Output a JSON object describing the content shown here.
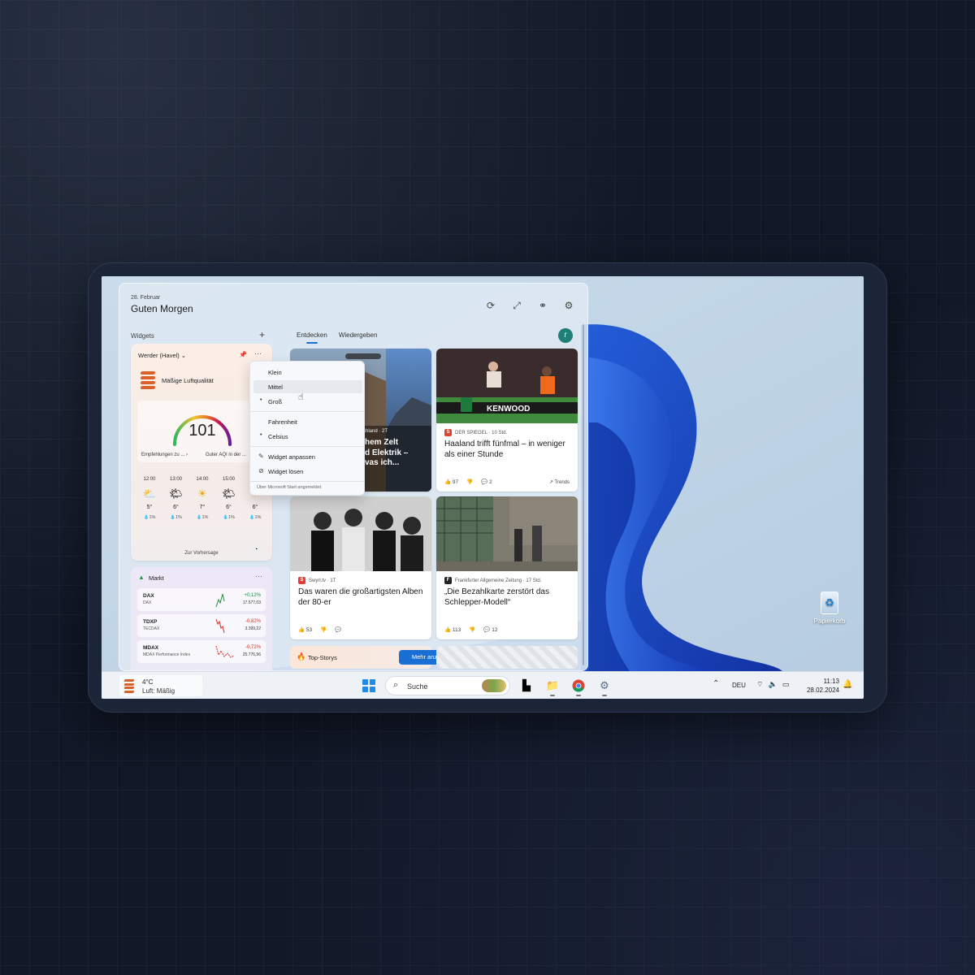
{
  "header": {
    "date": "28. Februar",
    "greeting": "Guten Morgen",
    "icons": [
      "refresh-icon",
      "expand-icon",
      "people-icon",
      "settings-icon"
    ]
  },
  "widgets_label": "Widgets",
  "tabs": [
    {
      "label": "Entdecken",
      "active": true
    },
    {
      "label": "Wiedergeben",
      "active": false
    }
  ],
  "avatar_initial": "r",
  "weather": {
    "location": "Werder (Havel)",
    "aq_title": "Mäßige Luftqualität",
    "aqi": "101",
    "recommend": "Empfehlungen zu ...",
    "recommend_arrow": "›",
    "aqi_note": "Guter AQI in der ...",
    "hours": [
      {
        "time": "12:00",
        "icon": "partly-cloudy-icon",
        "temp": "5°",
        "precip": "1%"
      },
      {
        "time": "13:00",
        "icon": "partly-sunny-icon",
        "temp": "6°",
        "precip": "1%"
      },
      {
        "time": "14:00",
        "icon": "sunny-icon",
        "temp": "7°",
        "precip": "1%"
      },
      {
        "time": "15:00",
        "icon": "partly-sunny-icon",
        "temp": "6°",
        "precip": "1%"
      },
      {
        "time": "16",
        "icon": "sunny-icon",
        "temp": "6°",
        "precip": "1%"
      }
    ],
    "forecast_link": "Zur Vorhersage"
  },
  "market": {
    "title": "Markt",
    "rows": [
      {
        "symbol": "DAX",
        "name": "DAX",
        "change": "+0,12%",
        "value": "17.577,03",
        "up": true
      },
      {
        "symbol": "TDXP",
        "name": "TECDAX",
        "change": "-0,82%",
        "value": "3.399,22",
        "up": false
      },
      {
        "symbol": "MDAX",
        "name": "MDAX Performance Index",
        "change": "-0,72%",
        "value": "25.776,96",
        "up": false
      }
    ]
  },
  "context_menu": {
    "sizes": [
      {
        "label": "Klein",
        "selected": false
      },
      {
        "label": "Mittel",
        "selected": false,
        "hovered": true
      },
      {
        "label": "Groß",
        "selected": true
      }
    ],
    "units": [
      {
        "label": "Fahrenheit",
        "selected": false
      },
      {
        "label": "Celsius",
        "selected": true
      }
    ],
    "actions": [
      {
        "label": "Widget anpassen",
        "icon": "pencil-icon"
      },
      {
        "label": "Widget lösen",
        "icon": "unpin-icon"
      }
    ],
    "footer": "Über Microsoft Start angemeldet"
  },
  "news": [
    {
      "source": "chland · 2T",
      "headline": "hem Zelt\nd Elektrik –\nvas ich..."
    },
    {
      "source": "DER SPIEGEL · 10 Std.",
      "source_logo": "S",
      "source_color": "#e2412d",
      "headline": "Haaland trifft fünfmal – in weniger als einer Stunde",
      "likes": "97",
      "comments": "2",
      "trend": "Trends",
      "banner": "KENWOOD"
    },
    {
      "source": "Swyrl.tv · 1T",
      "source_logo": "S",
      "source_color": "#e53935",
      "headline": "Das waren die großartigsten Alben der 80-er",
      "likes": "53",
      "comments": ""
    },
    {
      "source": "Frankfurter Allgemeine Zeitung · 17 Std.",
      "source_logo": "F",
      "source_color": "#222222",
      "headline": "„Die Bezahlkarte zerstört das Schlepper-Modell“",
      "likes": "113",
      "comments": "12"
    }
  ],
  "top_stories": {
    "label": "Top-Storys",
    "button": "Mehr anzeigen",
    "button_arrow": "›"
  },
  "desktop": {
    "recycle_label": "Papierkorb"
  },
  "taskbar": {
    "weather_temp": "4°C",
    "weather_air": "Luft: Mäßig",
    "search_placeholder": "Suche",
    "lang": "DEU",
    "time": "11:13",
    "date": "28.02.2024"
  },
  "colors": {
    "accent": "#1a6fd4",
    "positive": "#1e8e3e",
    "negative": "#d93025"
  }
}
